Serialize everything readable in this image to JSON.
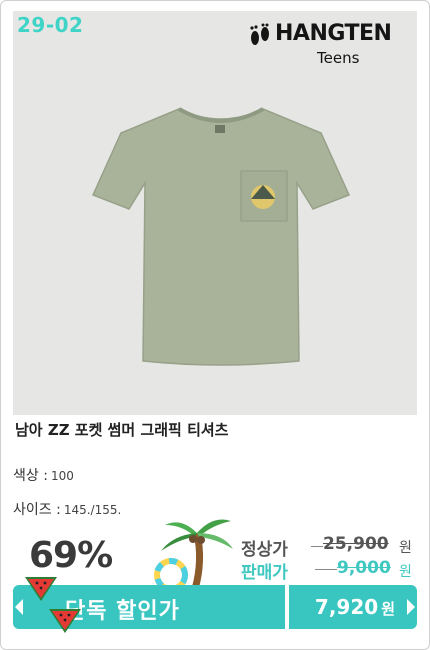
{
  "product": {
    "item_code": "29-02",
    "brand_name": "HANGTEN",
    "brand_sub": "Teens",
    "title": "남아 ZZ 포켓 썸머 그래픽 티셔츠",
    "color_label": "색상 :",
    "color_value": "100",
    "size_label": "사이즈 :",
    "size_value": "145./155."
  },
  "pricing": {
    "discount": "69%",
    "regular_label": "정상가",
    "regular_price": "25,900",
    "sale_label": "판매가",
    "sale_price": "9,000",
    "currency": "원"
  },
  "banner": {
    "label": "단독 할인가",
    "price": "7,920",
    "currency": "원"
  },
  "colors": {
    "accent": "#39c6c0",
    "shirt": "#a9b39a",
    "background": "#e6e6e4"
  }
}
